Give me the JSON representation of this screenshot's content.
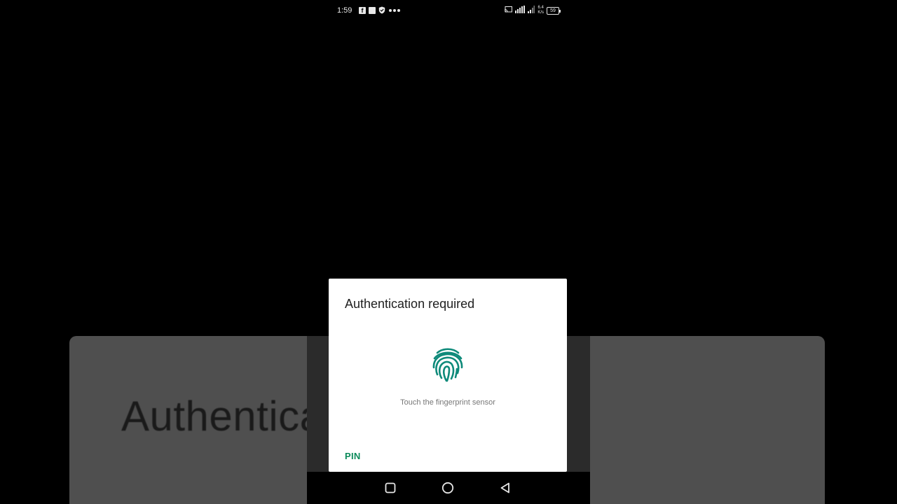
{
  "status_bar": {
    "time": "1:59",
    "facebook_glyph": "f",
    "network_speed_top": "6.4",
    "network_speed_bottom": "K/s",
    "battery": "59"
  },
  "background": {
    "title_fragment": "Authentica"
  },
  "dialog": {
    "title": "Authentication required",
    "hint": "Touch the fingerprint sensor",
    "pin_label": "PIN"
  },
  "icons": {
    "fingerprint": "fingerprint-icon",
    "accent_color": "#0b8a5a"
  },
  "nav": {
    "recent": "recent-apps-icon",
    "home": "home-icon",
    "back": "back-icon"
  }
}
